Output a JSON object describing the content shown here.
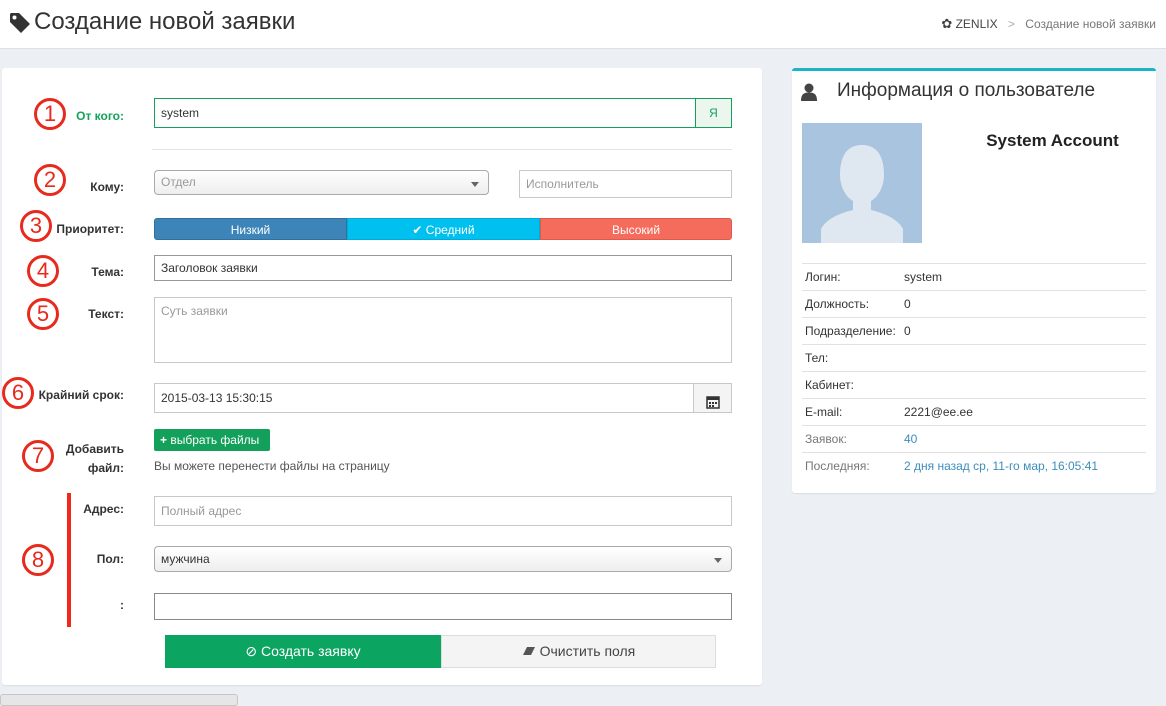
{
  "header": {
    "title": "Создание новой заявки",
    "breadcrumb_root": "ZENLIX",
    "breadcrumb_sep": ">",
    "breadcrumb_current": "Создание новой заявки"
  },
  "form": {
    "badges": [
      "1",
      "2",
      "3",
      "4",
      "5",
      "6",
      "7",
      "8"
    ],
    "from": {
      "label": "От кого:",
      "value": "system",
      "addon": "Я"
    },
    "to": {
      "label": "Кому:",
      "dept_placeholder": "Отдел",
      "executor_placeholder": "Исполнитель"
    },
    "priority": {
      "label": "Приоритет:",
      "low": "Низкий",
      "mid": "Средний",
      "high": "Высокий",
      "selected": "Средний"
    },
    "subject": {
      "label": "Тема:",
      "value": "Заголовок заявки"
    },
    "text": {
      "label": "Текст:",
      "placeholder": "Суть заявки"
    },
    "deadline": {
      "label": "Крайний срок:",
      "value": "2015-03-13 15:30:15"
    },
    "files": {
      "label_line1": "Добавить",
      "label_line2": "файл:",
      "button": "выбрать файлы",
      "hint": "Вы можете перенести файлы на страницу"
    },
    "address": {
      "label": "Адрес:",
      "placeholder": "Полный адрес"
    },
    "gender": {
      "label": "Пол:",
      "value": "мужчина"
    },
    "extra": {
      "label": ":",
      "value": ""
    },
    "buttons": {
      "create": "Создать заявку",
      "clear": "Очистить поля"
    }
  },
  "user_info": {
    "title": "Информация о пользователе",
    "account_name": "System Account",
    "fields": [
      {
        "key": "Логин:",
        "value": "system"
      },
      {
        "key": "Должность:",
        "value": "0"
      },
      {
        "key": "Подразделение:",
        "value": "0"
      },
      {
        "key": "Тел:",
        "value": ""
      },
      {
        "key": "Кабинет:",
        "value": ""
      },
      {
        "key": "E-mail:",
        "value": "2221@ee.ee"
      },
      {
        "key": "Заявок:",
        "value": "40"
      },
      {
        "key": "Последняя:",
        "value": "2 дня назад ср, 11-го мар, 16:05:41"
      }
    ]
  },
  "colors": {
    "green": "#12a05a",
    "priority_low": "#3d85b8",
    "priority_mid": "#00c0ef",
    "priority_high": "#f56c5d",
    "accent": "#1bb4c7",
    "badge_red": "#e8291d"
  },
  "icons": {
    "title": "tag-icon",
    "breadcrumb": "cog-icon",
    "calendar": "calendar-icon",
    "add": "plus-icon",
    "create": "check-circle-icon",
    "clear": "eraser-icon",
    "user": "user-icon"
  }
}
